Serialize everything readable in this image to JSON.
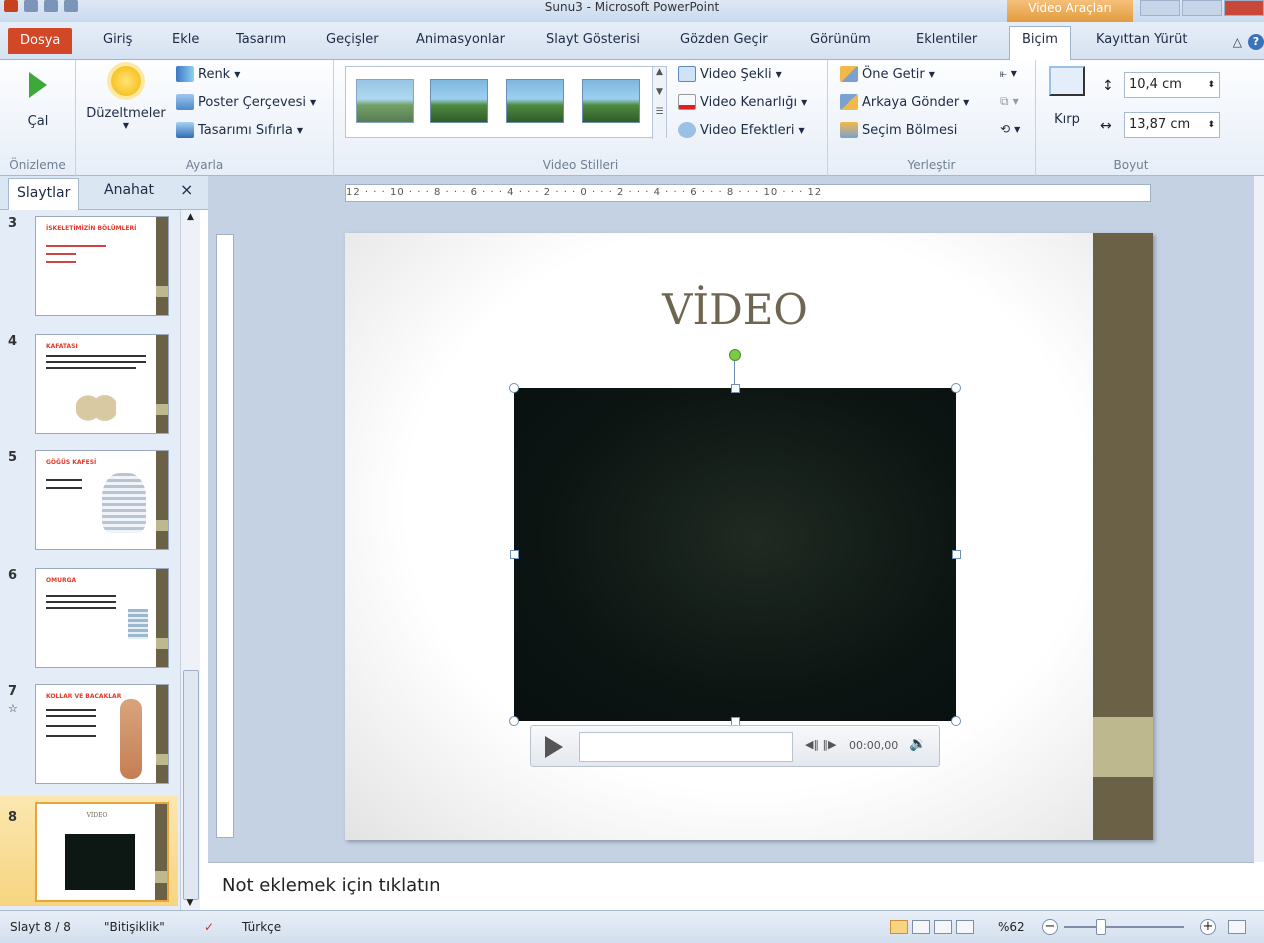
{
  "window": {
    "title": "Sunu3 - Microsoft PowerPoint",
    "contextual_tab_group": "Video Araçları"
  },
  "tabs": [
    {
      "label": "Dosya"
    },
    {
      "label": "Giriş"
    },
    {
      "label": "Ekle"
    },
    {
      "label": "Tasarım"
    },
    {
      "label": "Geçişler"
    },
    {
      "label": "Animasyonlar"
    },
    {
      "label": "Slayt Gösterisi"
    },
    {
      "label": "Gözden Geçir"
    },
    {
      "label": "Görünüm"
    },
    {
      "label": "Eklentiler"
    },
    {
      "label": "Biçim"
    },
    {
      "label": "Kayıttan Yürüt"
    }
  ],
  "ribbon": {
    "preview": {
      "play_label": "Çal",
      "group_label": "Önizleme"
    },
    "adjust": {
      "corrections_label": "Düzeltmeler",
      "color_label": "Renk",
      "poster_label": "Poster Çerçevesi",
      "reset_label": "Tasarımı Sıfırla",
      "group_label": "Ayarla"
    },
    "styles": {
      "shape_label": "Video Şekli",
      "border_label": "Video Kenarlığı",
      "effects_label": "Video Efektleri",
      "group_label": "Video Stilleri"
    },
    "arrange": {
      "front_label": "Öne Getir",
      "back_label": "Arkaya Gönder",
      "selection_label": "Seçim Bölmesi",
      "group_label": "Yerleştir"
    },
    "size": {
      "crop_label": "Kırp",
      "height": "10,4 cm",
      "width": "13,87 cm",
      "group_label": "Boyut"
    }
  },
  "pane": {
    "tab_slides": "Slaytlar",
    "tab_outline": "Anahat",
    "slides": [
      {
        "num": "3",
        "title": "İSKELETİMİZİN BÖLÜMLERİ"
      },
      {
        "num": "4",
        "title": "KAFATASI"
      },
      {
        "num": "5",
        "title": "GÖĞÜS KAFESİ"
      },
      {
        "num": "6",
        "title": "OMURGA"
      },
      {
        "num": "7",
        "title": "KOLLAR VE BACAKLAR"
      },
      {
        "num": "8",
        "title": "VİDEO"
      }
    ]
  },
  "ruler": {
    "h_labels": "12 · · · 10 · · · 8 · · · 6 · · · 4 · · · 2 · · · 0 · · · 2 · · · 4 · · · 6 · · · 8 · · · 10 · · · 12"
  },
  "slide": {
    "title": "VİDEO"
  },
  "player": {
    "time": "00:00,00"
  },
  "notes": {
    "placeholder": "Not eklemek için tıklatın"
  },
  "status": {
    "slide_info": "Slayt 8 / 8",
    "theme": "\"Bitişiklik\"",
    "language": "Türkçe",
    "zoom": "%62"
  },
  "colors": {
    "accent_file_tab": "#d24726",
    "slide_bar": "#6a6147",
    "slide_bar_accent": "#bdb88e",
    "title_color": "#6e6650"
  }
}
